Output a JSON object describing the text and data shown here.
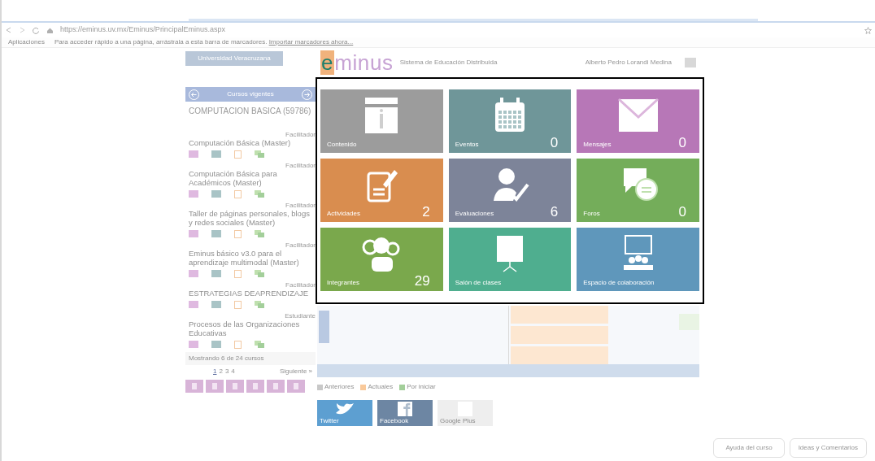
{
  "browser": {
    "url": "https://eminus.uv.mx/Eminus/PrincipalEminus.aspx",
    "bookmarks_bar": {
      "apps": "Aplicaciones",
      "hint": "Para acceder rápido a una página, arrástrala a esta barra de marcadores.",
      "import_link": "Importar marcadores ahora..."
    }
  },
  "header": {
    "university": "Universidad Veracruzana",
    "logo": "eminus",
    "subtitle": "Sistema de Educación Distribuida",
    "user": "Alberto Pedro Lorandi Medina"
  },
  "sidebar": {
    "title": "Cursos vigentes",
    "current_course": "COMPUTACION BASICA (59786)",
    "courses": [
      {
        "title": "Computación Básica (Master)",
        "role": "Facilitador"
      },
      {
        "title": "Computación Básica para Académicos (Master)",
        "role": "Facilitador"
      },
      {
        "title": "Taller de páginas personales, blogs y redes sociales (Master)",
        "role": "Facilitador"
      },
      {
        "title": "Eminus básico v3.0 para el aprendizaje multimodal (Master)",
        "role": "Facilitador"
      },
      {
        "title": "ESTRATEGIAS DEAPRENDIZAJE",
        "role": "Facilitador"
      },
      {
        "title": "Procesos de las Organizaciones Educativas",
        "role": "Estudiante"
      }
    ],
    "showing": "Mostrando 6 de 24 cursos",
    "pages": [
      {
        "label": "1",
        "selected": true
      },
      {
        "label": "2",
        "selected": false
      },
      {
        "label": "3",
        "selected": false
      },
      {
        "label": "4",
        "selected": false
      }
    ],
    "next": "Siguiente »"
  },
  "tiles": [
    {
      "kind": "content",
      "label": "Contenido",
      "color": "#9c9c9c"
    },
    {
      "kind": "events",
      "label": "Eventos",
      "count": "0",
      "color": "#6f9699"
    },
    {
      "kind": "messages",
      "label": "Mensajes",
      "count": "0",
      "color": "#b777b7"
    },
    {
      "kind": "activities",
      "label": "Actividades",
      "count": "2",
      "color": "#d98d4f"
    },
    {
      "kind": "evaluations",
      "label": "Evaluaciones",
      "count": "6",
      "color": "#7d8499"
    },
    {
      "kind": "forums",
      "label": "Foros",
      "count": "0",
      "color": "#74ad5a"
    },
    {
      "kind": "members",
      "label": "Integrantes",
      "count": "29",
      "color": "#7aa84c"
    },
    {
      "kind": "classroom",
      "label": "Salón de clases",
      "color": "#4fae8f"
    },
    {
      "kind": "collaboration",
      "label": "Espacio de colaboración",
      "color": "#5f97bb"
    }
  ],
  "legend": [
    {
      "label": "Anteriores",
      "color": "#c8c8c8"
    },
    {
      "label": "Actuales",
      "color": "#f9c99a"
    },
    {
      "label": "Por iniciar",
      "color": "#a3cf9a"
    }
  ],
  "social": [
    {
      "kind": "twitter",
      "label": "Twitter"
    },
    {
      "kind": "facebook",
      "label": "Facebook"
    },
    {
      "kind": "google",
      "label": "Google Plus"
    }
  ],
  "footer": {
    "help": "Ayuda del curso",
    "ideas": "Ideas y Comentarios"
  }
}
